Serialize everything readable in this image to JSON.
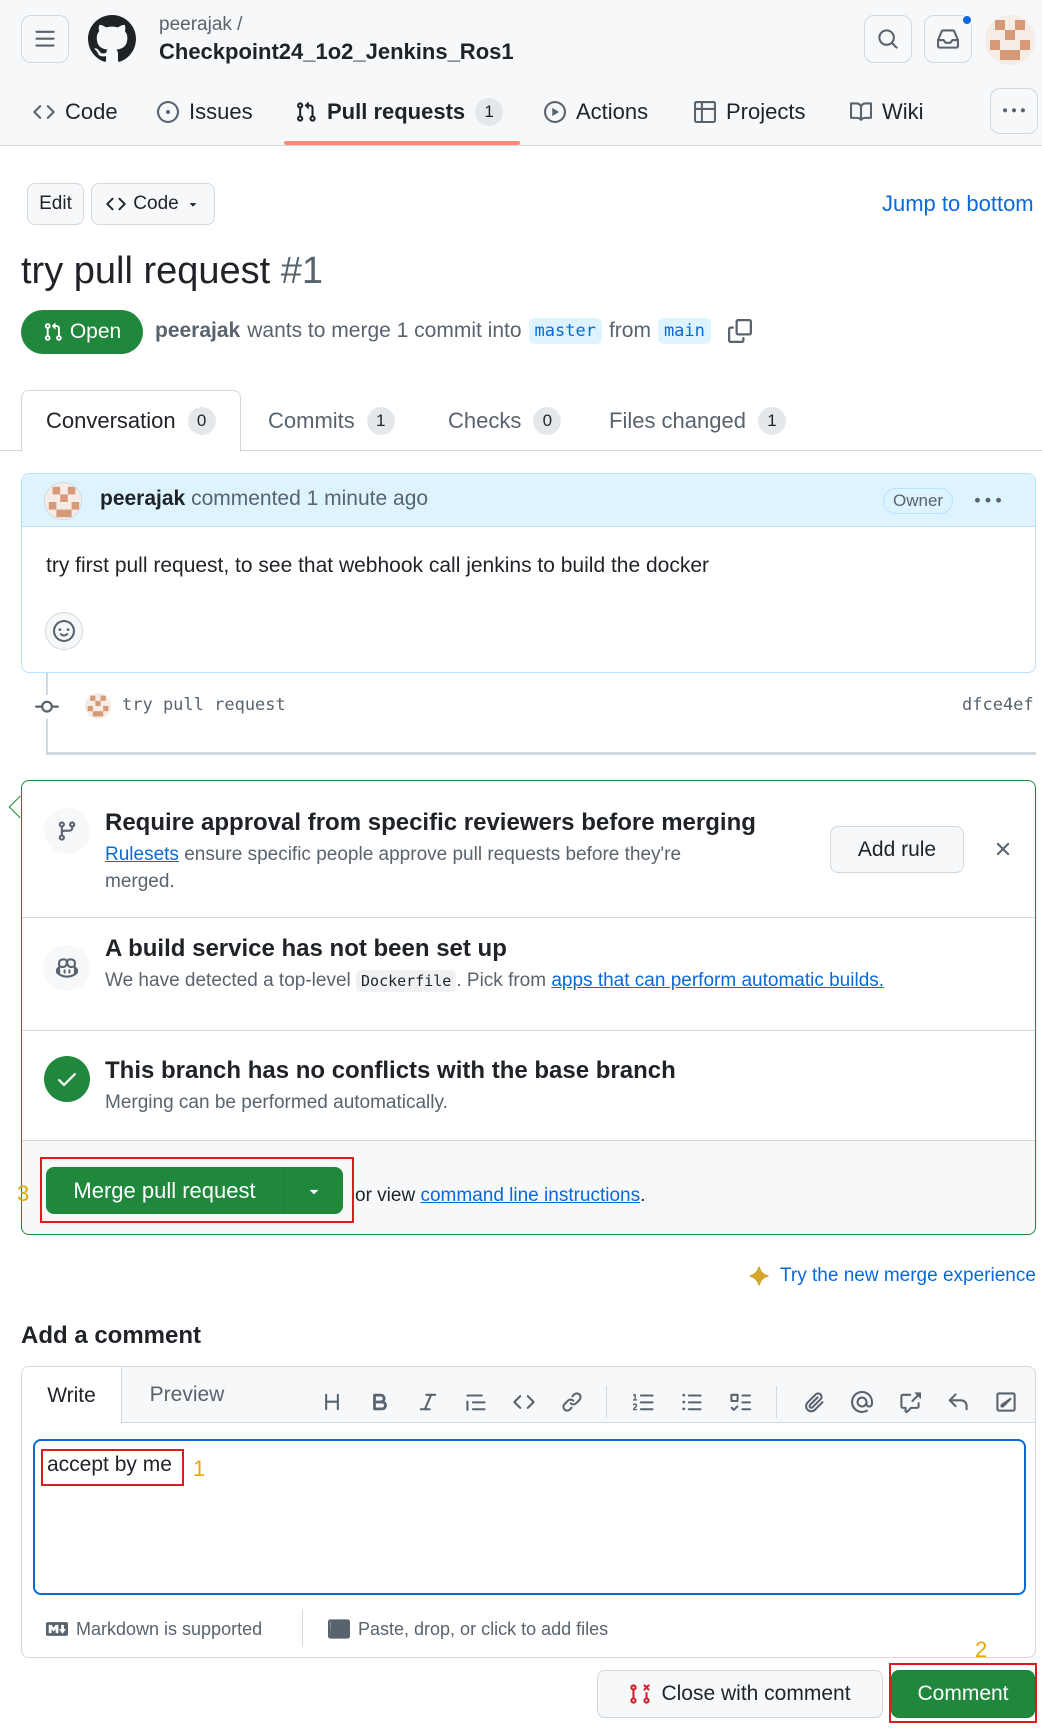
{
  "header": {
    "owner": "peerajak /",
    "repo": "Checkpoint24_1o2_Jenkins_Ros1",
    "nav": [
      {
        "label": "Code"
      },
      {
        "label": "Issues"
      },
      {
        "label": "Pull requests",
        "count": "1"
      },
      {
        "label": "Actions"
      },
      {
        "label": "Projects"
      },
      {
        "label": "Wiki"
      }
    ],
    "accent": "#fd8c73"
  },
  "pr": {
    "edit_label": "Edit",
    "code_label": "Code",
    "jump_label": "Jump to bottom",
    "title": "try pull request",
    "number": "#1",
    "state": "Open",
    "author": "peerajak",
    "merge_text": "wants to merge 1 commit into",
    "base": "master",
    "from_text": "from",
    "head": "main"
  },
  "tabs": [
    {
      "label": "Conversation",
      "count": "0"
    },
    {
      "label": "Commits",
      "count": "1"
    },
    {
      "label": "Checks",
      "count": "0"
    },
    {
      "label": "Files changed",
      "count": "1"
    }
  ],
  "comment": {
    "author": "peerajak",
    "meta": "commented 1 minute ago",
    "badge": "Owner",
    "body": "try first pull request, to see that webhook call jenkins to build the docker"
  },
  "commit": {
    "message": "try pull request",
    "sha": "dfce4ef"
  },
  "merge": {
    "rule_title": "Require approval from specific reviewers before merging",
    "rule_link": "Rulesets",
    "rule_text": "ensure specific people approve pull requests before they're",
    "rule_text2": "merged.",
    "add_rule": "Add rule",
    "build_title": "A build service has not been set up",
    "build_text1": "We have detected a top-level",
    "build_code": "Dockerfile",
    "build_text2": ". Pick from",
    "build_link": "apps that can perform automatic builds.",
    "ok_title": "This branch has no conflicts with the base branch",
    "ok_text": "Merging can be performed automatically.",
    "merge_button": "Merge pull request",
    "or_view": "or view",
    "cli_link": "command line instructions",
    "period": ".",
    "green": "#1f883d"
  },
  "new_merge": "Try the new merge experience",
  "add_comment": {
    "heading": "Add a comment",
    "write_tab": "Write",
    "preview_tab": "Preview",
    "value": "accept by me",
    "markdown": "Markdown is supported",
    "attach": "Paste, drop, or click to add files",
    "close_button": "Close with comment",
    "comment_button": "Comment"
  },
  "annotations": {
    "a1": "1",
    "a2": "2",
    "a3": "3"
  }
}
